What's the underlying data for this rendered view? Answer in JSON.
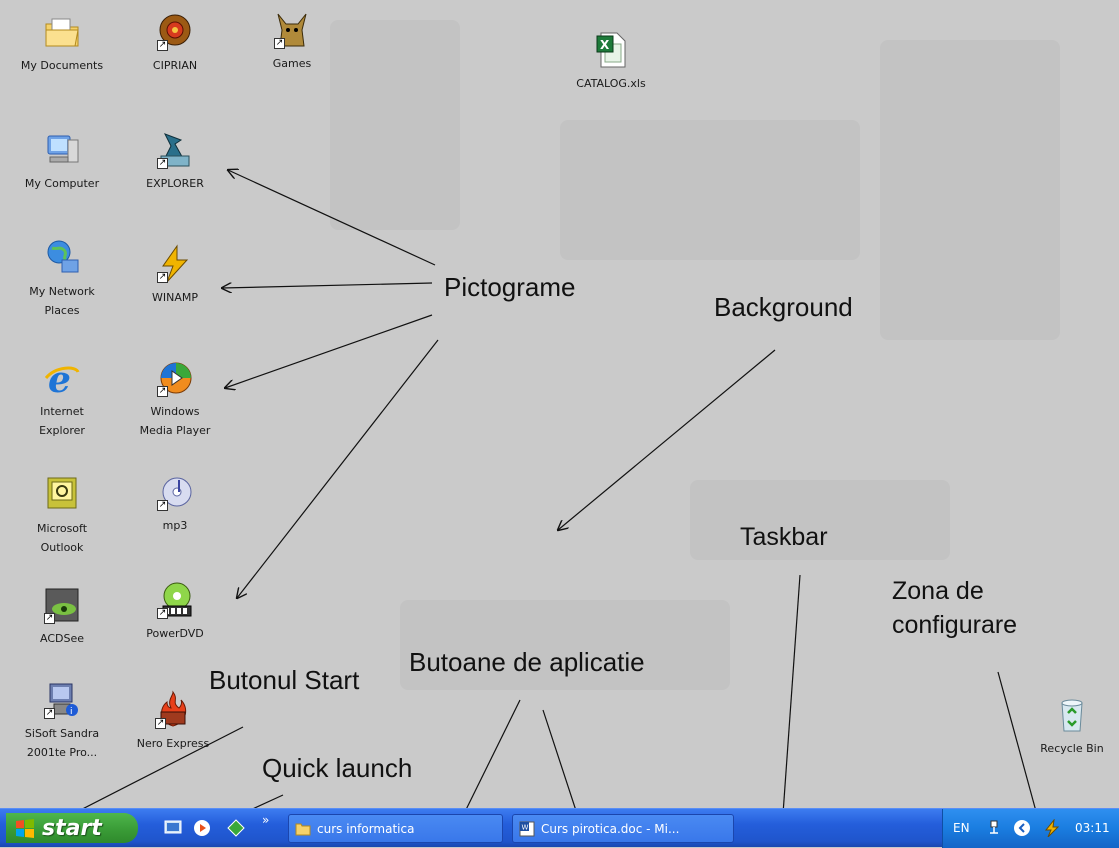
{
  "desktop_icons": {
    "my_documents": "My Documents",
    "ciprian": "CIPRIAN",
    "games": "Games",
    "catalog": "CATALOG.xls",
    "my_computer": "My Computer",
    "explorer": "EXPLORER",
    "network_line1": "My Network",
    "network_line2": "Places",
    "winamp": "WINAMP",
    "ie_line1": "Internet",
    "ie_line2": "Explorer",
    "wmp_line1": "Windows",
    "wmp_line2": "Media Player",
    "outlook_line1": "Microsoft",
    "outlook_line2": "Outlook",
    "mp3": "mp3",
    "acdsee": "ACDSee",
    "powerdvd": "PowerDVD",
    "sisoft_line1": "SiSoft Sandra",
    "sisoft_line2": "2001te Pro...",
    "nero": "Nero Express",
    "recycle_bin": "Recycle Bin"
  },
  "annotations": {
    "pictograme": "Pictograme",
    "background": "Background",
    "taskbar": "Taskbar",
    "zona_line1": "Zona de",
    "zona_line2": "configurare",
    "butonul_start": "Butonul Start",
    "butoane": "Butoane de aplicatie",
    "quick_launch": "Quick launch"
  },
  "taskbar": {
    "start_label": "start",
    "quick_launch_more": "»",
    "task1": "curs informatica",
    "task2": "Curs pirotica.doc - Mi...",
    "language": "EN",
    "clock": "03:11"
  },
  "colors": {
    "desktop_bg": "#cacaca",
    "taskbar_blue": "#245edb",
    "start_green": "#3a9c37",
    "tray_blue": "#1a7de0"
  }
}
